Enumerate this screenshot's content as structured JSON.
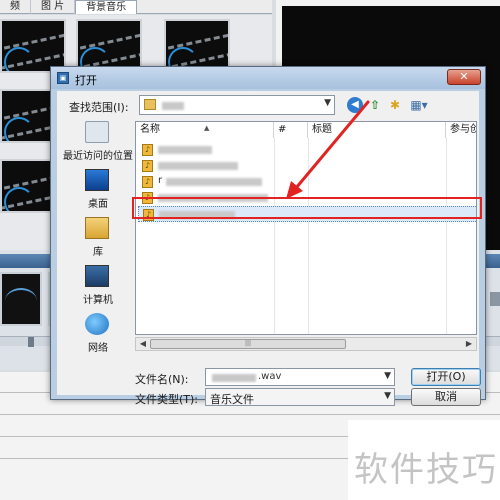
{
  "app": {
    "tabs": [
      "频",
      "图 片",
      "背景音乐"
    ],
    "active_tab": "背景音乐"
  },
  "dialog": {
    "title": "打开",
    "look_in_label": "查找范围(I):",
    "columns": [
      "名称",
      "#",
      "标题",
      "参与创"
    ],
    "files": [
      {
        "visible_text": ""
      },
      {
        "visible_text": ""
      },
      {
        "visible_text": "r"
      },
      {
        "visible_text": ""
      },
      {
        "visible_text": "",
        "selected": true
      }
    ],
    "places": [
      {
        "label": "最近访问的位置",
        "icon": "recent-places-icon"
      },
      {
        "label": "桌面",
        "icon": "desktop-icon"
      },
      {
        "label": "库",
        "icon": "library-icon"
      },
      {
        "label": "计算机",
        "icon": "computer-icon"
      },
      {
        "label": "网络",
        "icon": "network-icon"
      }
    ],
    "file_name_label": "文件名(N):",
    "file_name_value": ".wav",
    "file_type_label": "文件类型(T):",
    "file_type_value": "音乐文件",
    "open_button": "打开(O)",
    "cancel_button": "取消",
    "scroll_grip": "|||"
  },
  "watermark": "软件技巧",
  "colors": {
    "highlight": "#e32222",
    "title_bar": "#b9cde3",
    "selection": "#dbe9fb"
  }
}
